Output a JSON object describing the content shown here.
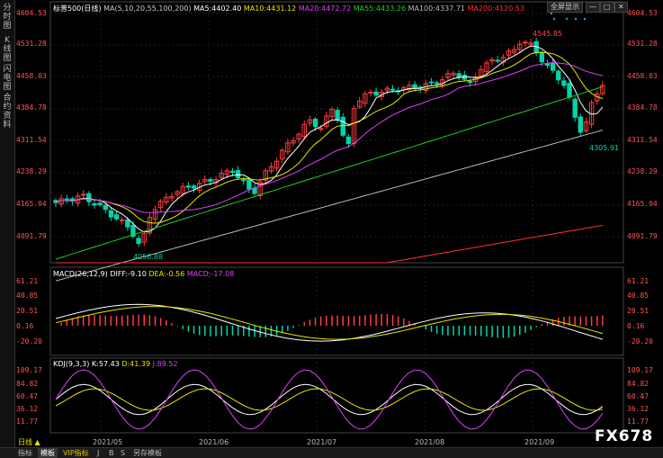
{
  "left_tabs": [
    "分时图",
    "K线图",
    "闪电图",
    "合约资料"
  ],
  "top_buttons": {
    "fullscreen": "全屏显示",
    "minimize": "—",
    "restore": "□",
    "close": "✕"
  },
  "main_header": {
    "symbol": "标普500",
    "period": "日线",
    "ma_settings": "MA(5,10,20,55,100,200)",
    "ma5": "MA5:4402.40",
    "ma10": "MA10:4431.12",
    "ma20": "MA20:4472.72",
    "ma55": "MA55:4433.26",
    "ma100": "MA100:4337.71",
    "ma200": "MA200:4120.53"
  },
  "price_axis": [
    "4604.53",
    "4531.28",
    "4458.03",
    "4384.78",
    "4311.54",
    "4238.29",
    "4165.04",
    "4091.79"
  ],
  "annotations": {
    "high": "4545.85",
    "low_left": "4056.88",
    "low_right": "4305.91"
  },
  "macd_header": {
    "name": "MACD(26,12,9)",
    "diff": "DIFF:-9.10",
    "dea": "DEA:-0.56",
    "macd": "MACD:-17.08"
  },
  "macd_axis": [
    "61.21",
    "40.85",
    "20.51",
    "0.16",
    "-20.20"
  ],
  "kdj_header": {
    "name": "KDJ(9,3,3)",
    "k": "K:57.43",
    "d": "D:41.39",
    "j": "J:89.52"
  },
  "kdj_axis": [
    "109.17",
    "84.82",
    "60.47",
    "36.12",
    "11.77"
  ],
  "x_labels": [
    "2021/05",
    "2021/06",
    "2021/07",
    "2021/08",
    "2021/09"
  ],
  "bottom_tabs": [
    "日线",
    "指标",
    "模板",
    "VIP指标",
    "J",
    "B",
    "S",
    "另存模板"
  ],
  "watermark": "FX678",
  "colors": {
    "up": "#ff3b3b",
    "down": "#00d4aa",
    "ma5": "#ffffff",
    "ma10": "#e6e600",
    "ma20": "#e040fb",
    "ma55": "#22cc22",
    "ma100": "#bbbbbb",
    "ma200": "#ff3030"
  },
  "chart_data": {
    "type": "line",
    "title": "标普500 日线",
    "x_range": [
      "2021/05",
      "2021/09"
    ],
    "ylim": [
      4060,
      4605
    ],
    "series": [
      {
        "name": "MA5",
        "values": [
          4402.4
        ]
      },
      {
        "name": "MA10",
        "values": [
          4431.12
        ]
      },
      {
        "name": "MA20",
        "values": [
          4472.72
        ]
      },
      {
        "name": "MA55",
        "values": [
          4433.26
        ]
      },
      {
        "name": "MA100",
        "values": [
          4337.71
        ]
      },
      {
        "name": "MA200",
        "values": [
          4120.53
        ]
      }
    ],
    "notes_high": 4545.85,
    "notes_lows": [
      4056.88,
      4305.91
    ]
  }
}
